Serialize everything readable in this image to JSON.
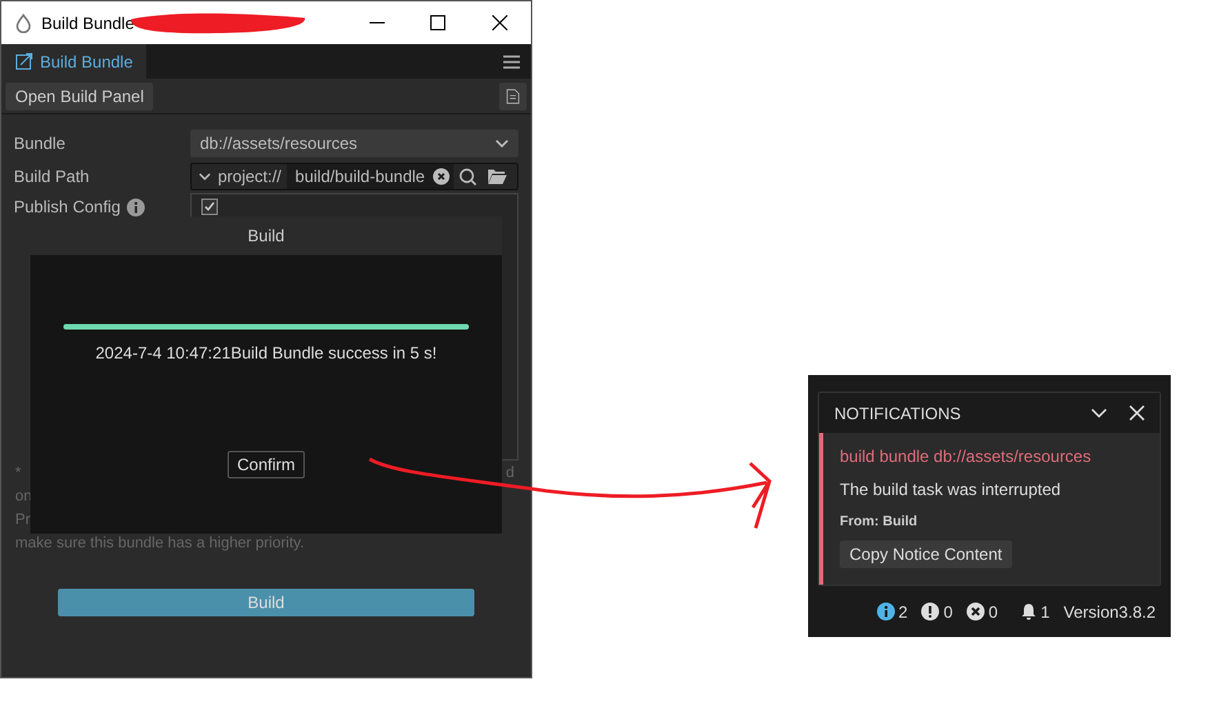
{
  "window": {
    "title": "Build Bundle",
    "panel_tab": {
      "label": "Build Bundle",
      "selected": true
    },
    "toolbar_button": "Open Build Panel",
    "form": [
      {
        "kind": "select",
        "label": "Bundle",
        "value": "db://assets/resources"
      },
      {
        "kind": "path",
        "label": "Build Path",
        "prefix": "project://",
        "value": "build/build-bundle"
      },
      {
        "kind": "config",
        "label": "Publish Config",
        "options": [
          {
            "checked": true
          }
        ]
      }
    ],
    "note_fragments": [
      "*",
      "on",
      "Pr"
    ],
    "note_tail": "d",
    "note_last": "make sure this bundle has a higher priority.",
    "build_button": "Build"
  },
  "dialog": {
    "title": "Build",
    "progress": {
      "level": 1
    },
    "message": "2024-7-4 10:47:21Build Bundle success in 5 s!",
    "confirm": "Confirm"
  },
  "notifications": {
    "title": "NOTIFICATIONS",
    "items": [
      {
        "title": "build bundle db://assets/resources",
        "body": "The build task was interrupted",
        "source": "From: Build",
        "action": "Copy Notice Content",
        "color": "#e06c7a"
      }
    ],
    "status": [
      {
        "kind": "info",
        "count": "2"
      },
      {
        "kind": "warn",
        "count": "0"
      },
      {
        "kind": "error",
        "count": "0"
      },
      {
        "kind": "bell",
        "count": "1"
      }
    ],
    "version": "Version3.8.2"
  }
}
